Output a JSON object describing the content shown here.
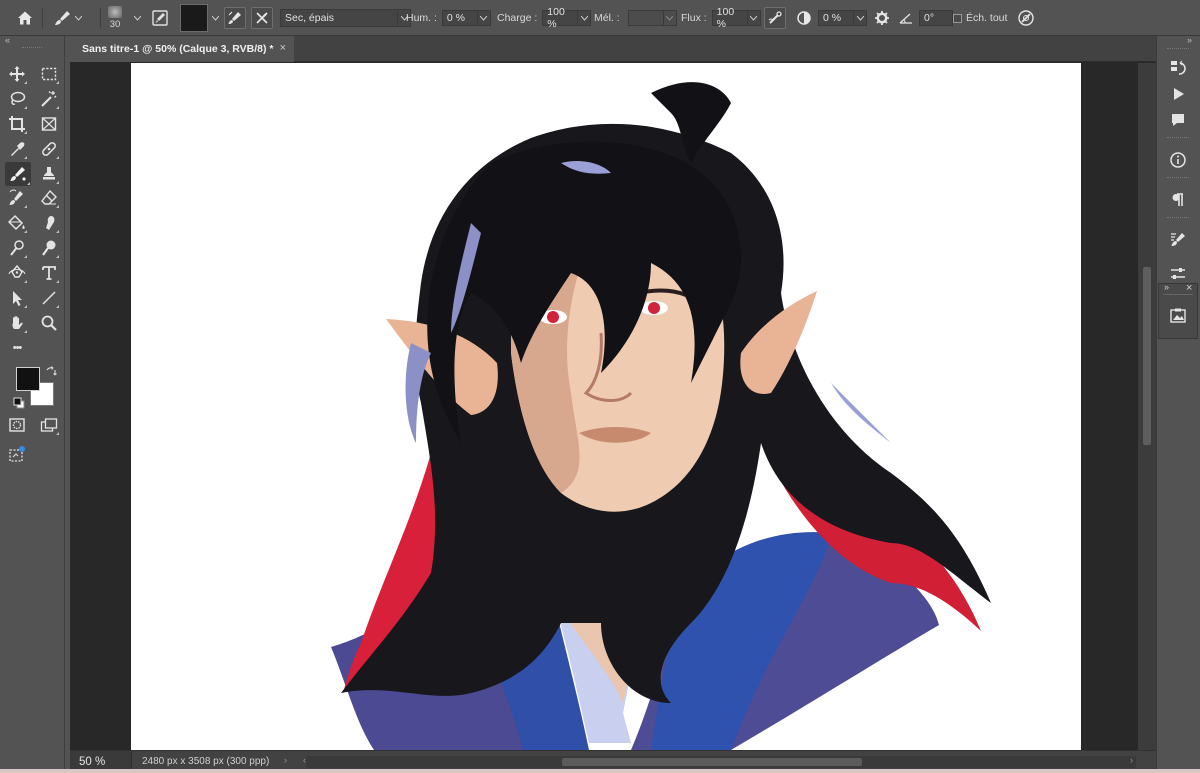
{
  "options_bar": {
    "brush_size": "30",
    "brush_preset": "Sec, épais",
    "hum_label": "Hum. :",
    "hum_value": "0 %",
    "charge_label": "Charge :",
    "charge_value": "100 %",
    "mel_label": "Mél. :",
    "mel_value": "",
    "flux_label": "Flux :",
    "flux_value": "100 %",
    "smoothing_value": "0 %",
    "angle_value": "0°",
    "sample_all_label": "Éch. tout",
    "foreground_color": "#1a1a1a"
  },
  "left_toolbar": {
    "collapse_glyph": "«",
    "more_glyph": "•••",
    "foreground_color": "#111111",
    "background_color": "#ffffff"
  },
  "document": {
    "tab_title": "Sans titre-1 @ 50% (Calque 3, RVB/8) *",
    "tab_close": "×",
    "zoom": "50 %",
    "doc_info": "2480 px x 3508 px (300 ppp)",
    "status_arrow": "›",
    "scroll_left": "‹",
    "scroll_right": "›"
  },
  "right_dock": {
    "collapse_glyph": "»",
    "float_close": "×",
    "float_collapse": "»"
  }
}
